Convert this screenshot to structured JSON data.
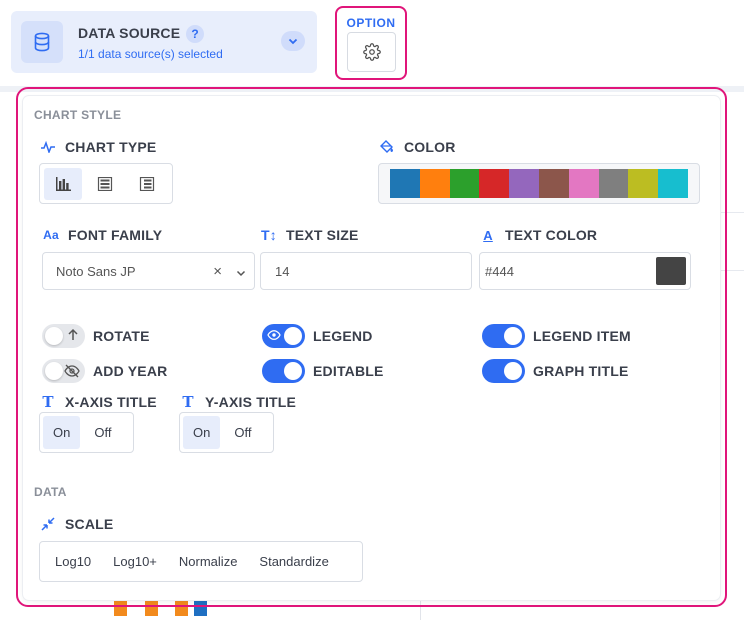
{
  "data_source": {
    "title": "DATA SOURCE",
    "help": "?",
    "subtitle": "1/1 data source(s) selected"
  },
  "option": {
    "label": "OPTION"
  },
  "chart_style": {
    "section_title": "CHART STYLE",
    "chart_type_label": "CHART TYPE",
    "color_label": "COLOR",
    "palette": [
      "#1f77b4",
      "#ff7f0e",
      "#2ca02c",
      "#d62728",
      "#9467bd",
      "#8c564b",
      "#e377c2",
      "#7f7f7f",
      "#bcbd22",
      "#17becf"
    ],
    "font_family_label": "FONT FAMILY",
    "font_family_value": "Noto Sans JP",
    "font_clear": "×",
    "text_size_label": "TEXT SIZE",
    "text_size_value": "14",
    "text_color_label": "TEXT COLOR",
    "text_color_value": "#444",
    "toggles": {
      "rotate": {
        "label": "ROTATE",
        "on": false
      },
      "legend": {
        "label": "LEGEND",
        "on": true
      },
      "legend_item": {
        "label": "LEGEND ITEM",
        "on": true
      },
      "add_year": {
        "label": "ADD YEAR",
        "on": false
      },
      "editable": {
        "label": "EDITABLE",
        "on": true
      },
      "graph_title": {
        "label": "GRAPH TITLE",
        "on": true
      }
    },
    "x_axis_title": {
      "label": "X-AXIS TITLE",
      "on": "On",
      "off": "Off",
      "selected": "On"
    },
    "y_axis_title": {
      "label": "Y-AXIS TITLE",
      "on": "On",
      "off": "Off",
      "selected": "On"
    }
  },
  "data": {
    "section_title": "DATA",
    "scale_label": "SCALE",
    "scale_options": [
      "Log10",
      "Log10+",
      "Normalize",
      "Standardize"
    ]
  },
  "colors": {
    "accent": "#2f6cf2",
    "highlight": "#e0157a"
  }
}
